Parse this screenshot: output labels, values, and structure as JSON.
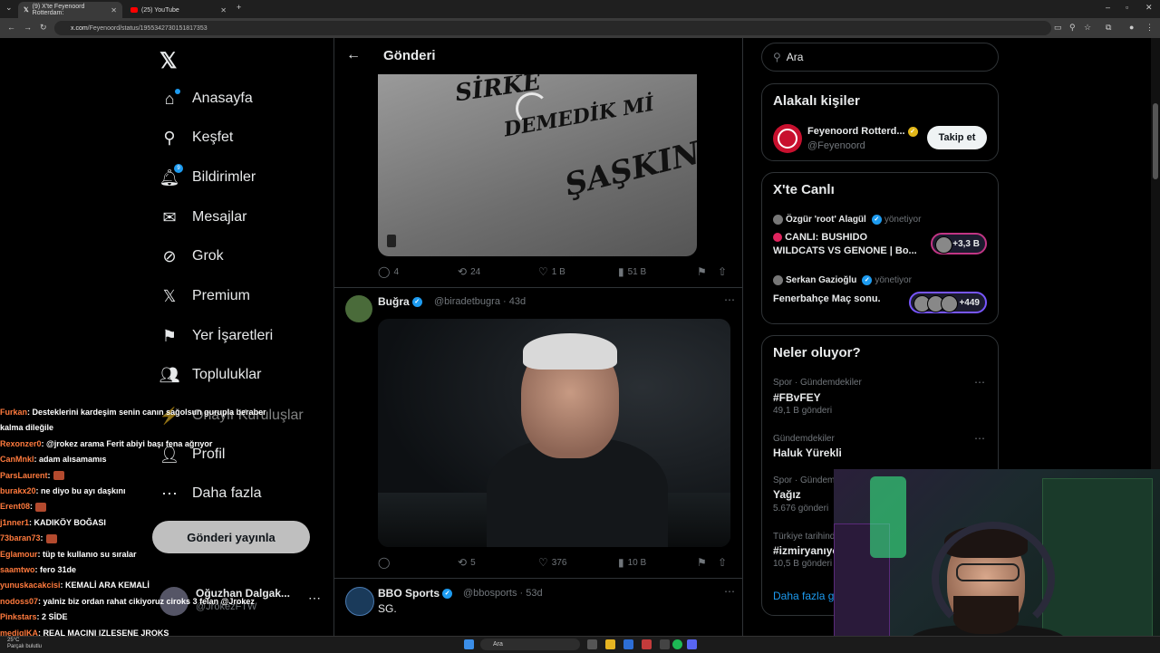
{
  "browser": {
    "tabs": [
      {
        "label": "(9) X'te Feyenoord Rotterdam:",
        "active": true
      },
      {
        "label": "(25) YouTube",
        "active": false
      }
    ],
    "url_host": "x.com",
    "url_path": "/Feyenoord/status/1955342730151817353"
  },
  "nav": {
    "items": [
      {
        "label": "Anasayfa",
        "icon": "home-icon"
      },
      {
        "label": "Keşfet",
        "icon": "search-icon"
      },
      {
        "label": "Bildirimler",
        "icon": "bell-icon",
        "badge": "9"
      },
      {
        "label": "Mesajlar",
        "icon": "mail-icon"
      },
      {
        "label": "Grok",
        "icon": "grok-icon"
      },
      {
        "label": "Premium",
        "icon": "x-icon"
      },
      {
        "label": "Yer İşaretleri",
        "icon": "bookmark-icon"
      },
      {
        "label": "Topluluklar",
        "icon": "communities-icon"
      },
      {
        "label": "Onaylı Kuruluşlar",
        "icon": "verified-org-icon"
      },
      {
        "label": "Profil",
        "icon": "profile-icon"
      },
      {
        "label": "Daha fazla",
        "icon": "more-circle-icon"
      }
    ],
    "post_button": "Gönderi yayınla",
    "account": {
      "name": "Oğuzhan Dalgak...",
      "handle": "@JrokezFTW"
    }
  },
  "chat": [
    {
      "user": "Furkan",
      "text": ": Desteklerini kardeşim senin canın sağolsun gurupla beraber"
    },
    {
      "user": "",
      "text": "kalma dileğile"
    },
    {
      "user": "Rexonzer0",
      "text": ": @jrokez arama Ferit abiyi başı fena ağrıyor"
    },
    {
      "user": "CanMnkl",
      "text": ": adam alısamamıs"
    },
    {
      "user": "ParsLaurent",
      "text": ":",
      "emote": true
    },
    {
      "user": "burakx20",
      "text": ": ne diyo bu ayı daşkını"
    },
    {
      "user": "Erent08",
      "text": ":",
      "emote": true
    },
    {
      "user": "j1nner1",
      "text": ": KADIKÖY BOĞASI"
    },
    {
      "user": "73baran73",
      "text": ":",
      "emote": true
    },
    {
      "user": "Eglamour",
      "text": ": tüp te kullanıo su sıralar"
    },
    {
      "user": "saamtwo",
      "text": ": fero 31de"
    },
    {
      "user": "yunuskacakcisi",
      "text": ": KEMALİ ARA KEMALİ"
    },
    {
      "user": "nodoss07",
      "text": ": yalniz biz ordan rahat cikiyoruz ciroks 3 felan @Jrokez"
    },
    {
      "user": "Pinkstars",
      "text": ": 2 SİDE"
    },
    {
      "user": "medigIKA",
      "text": ": REAL MACINI IZLESENE JROKS"
    }
  ],
  "main": {
    "header_title": "Gönderi",
    "media1_text": [
      "SİRKE",
      "DEMEDİK Mİ",
      "ŞAŞKIN"
    ],
    "tweet1_stats": {
      "replies": "4",
      "retweets": "24",
      "likes": "1 B",
      "views": "51 B"
    },
    "tweet2": {
      "name": "Buğra",
      "handle": "@biradetbugra",
      "time": "43d",
      "replies": "",
      "retweets": "5",
      "likes": "376",
      "views": "10 B"
    },
    "tweet3": {
      "name": "BBO Sports",
      "handle": "@bbosports",
      "time": "53d",
      "text": "SG."
    }
  },
  "right": {
    "search_placeholder": "Ara",
    "related": {
      "title": "Alakalı kişiler",
      "name": "Feyenoord Rotterd...",
      "handle": "@Feyenoord",
      "follow": "Takip et"
    },
    "live": {
      "title": "X'te Canlı",
      "items": [
        {
          "host": "Özgür 'root' Alagül",
          "role": "yönetiyor",
          "text1": "CANLI: BUSHIDO",
          "text2": "WILDCATS VS GENONE | Bo...",
          "count": "+3,3 B"
        },
        {
          "host": "Serkan Gazioğlu",
          "role": "yönetiyor",
          "text1": "Fenerbahçe Maç sonu.",
          "text2": "",
          "count": "+449"
        }
      ]
    },
    "trends": {
      "title": "Neler oluyor?",
      "items": [
        {
          "cat": "Spor · Gündemdekiler",
          "name": "#FBvFEY",
          "count": "49,1 B gönderi"
        },
        {
          "cat": "Gündemdekiler",
          "name": "Haluk Yürekli",
          "count": ""
        },
        {
          "cat": "Spor · Gündem",
          "name": "Yağız",
          "count": "5.676 gönderi"
        },
        {
          "cat": "Türkiye tarihinde",
          "name": "#izmiryanıyo",
          "count": "10,5 B gönderi"
        }
      ],
      "show_more": "Daha fazla gö"
    }
  },
  "taskbar": {
    "temp": "25°C",
    "weather": "Parçalı bulutlu",
    "search": "Ara"
  },
  "colors": {
    "accent": "#1d9bf0",
    "background": "#000000",
    "border": "#2f3336",
    "muted": "#71767b"
  }
}
